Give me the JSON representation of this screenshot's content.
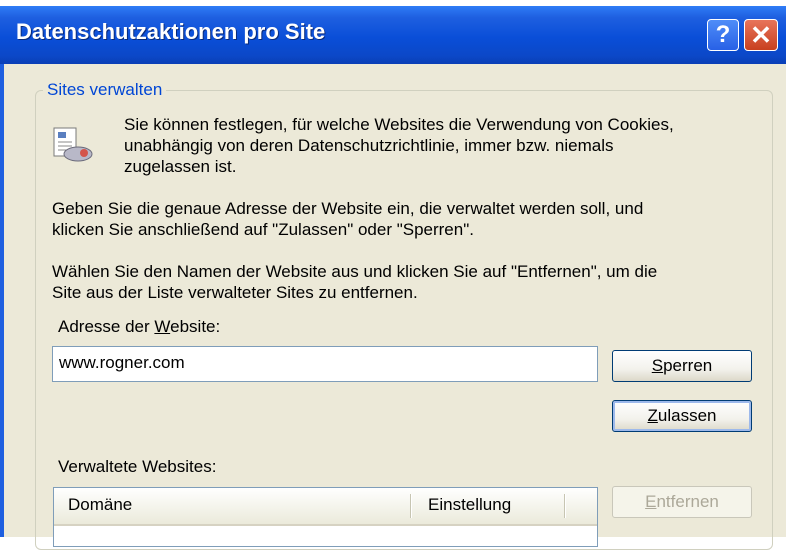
{
  "window": {
    "title": "Datenschutzaktionen pro Site",
    "help_glyph": "?",
    "close_glyph": "✕"
  },
  "group": {
    "label": "Sites verwalten"
  },
  "info": {
    "line1": "Sie können festlegen, für welche Websites die Verwendung von Cookies,",
    "line2": "unabhängig von deren Datenschutzrichtlinie, immer bzw. niemals",
    "line3": "zugelassen ist.",
    "icon": "privacy-report-icon"
  },
  "instructions": {
    "p1_line1": "Geben Sie die genaue Adresse der Website ein, die verwaltet werden soll, und",
    "p1_line2": "klicken Sie anschließend auf \"Zulassen\" oder \"Sperren\".",
    "p2_line1": "Wählen Sie den Namen der Website aus und klicken Sie auf \"Entfernen\", um die",
    "p2_line2": "Site aus der Liste verwalteter Sites zu entfernen."
  },
  "address": {
    "label_prefix": "Adresse der ",
    "label_accel": "W",
    "label_suffix": "ebsite:",
    "value": "www.rogner.com"
  },
  "buttons": {
    "block_accel": "S",
    "block_rest": "perren",
    "allow_accel": "Z",
    "allow_rest": "ulassen",
    "remove_accel": "E",
    "remove_rest": "ntfernen"
  },
  "managed": {
    "label": "Verwaltete Websites:",
    "columns": [
      "Domäne",
      "Einstellung"
    ],
    "rows": []
  },
  "colors": {
    "titlebar": "#0a4ed8",
    "dialog_bg": "#ece9d8",
    "group_label": "#0046d5"
  }
}
